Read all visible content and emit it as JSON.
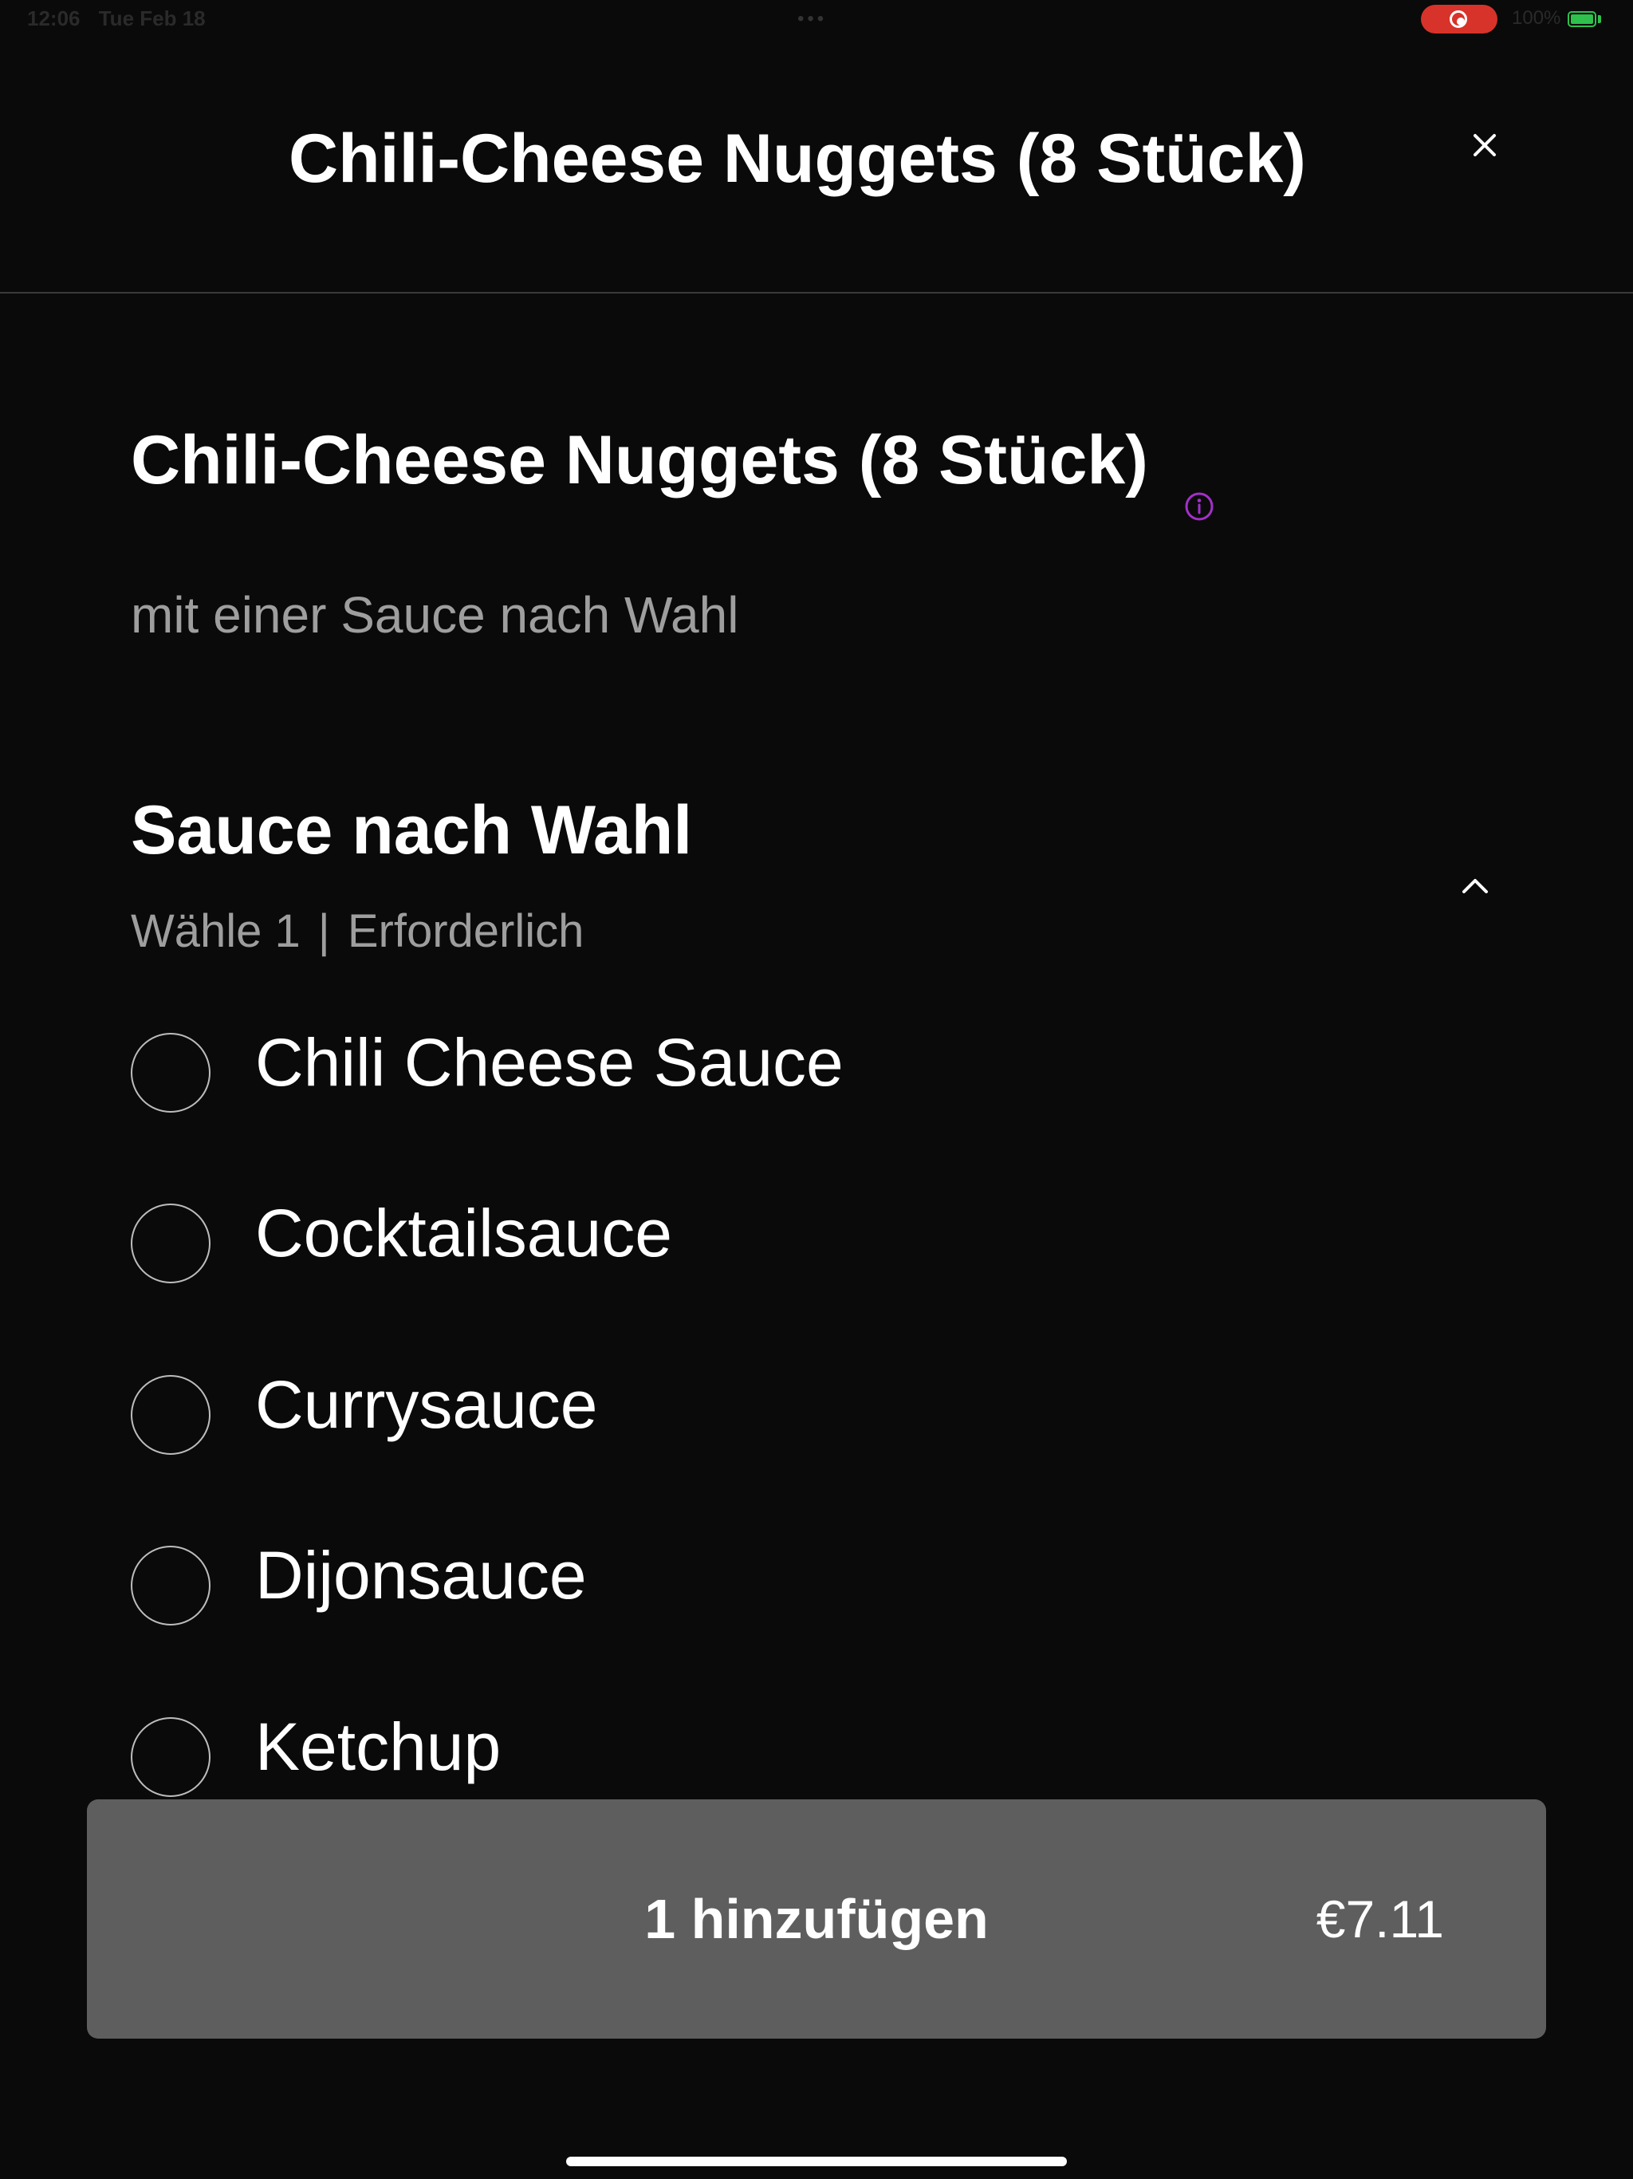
{
  "status_bar": {
    "time": "12:06",
    "date": "Tue Feb 18",
    "battery": "100%"
  },
  "header": {
    "title": "Chili-Cheese Nuggets (8 Stück)"
  },
  "item": {
    "title": "Chili-Cheese Nuggets (8 Stück)",
    "description": "mit einer Sauce nach Wahl"
  },
  "section": {
    "title": "Sauce nach Wahl",
    "choose": "Wähle 1",
    "separator": "|",
    "required": "Erforderlich",
    "options": [
      {
        "label": "Chili Cheese Sauce",
        "selected": false
      },
      {
        "label": "Cocktailsauce",
        "selected": false
      },
      {
        "label": "Currysauce",
        "selected": false
      },
      {
        "label": "Dijonsauce",
        "selected": false
      },
      {
        "label": "Ketchup",
        "selected": false
      }
    ]
  },
  "add_button": {
    "label": "1 hinzufügen",
    "price": "€7.11"
  },
  "colors": {
    "background": "#0a0a0a",
    "button": "#5e5e5e",
    "secondary_text": "#9e9e9e",
    "info_accent": "#a330c9",
    "record": "#d7332a",
    "battery": "#2ec14b"
  },
  "icons": {
    "close": "close-icon",
    "info": "info-icon",
    "collapse": "chevron-up-icon"
  }
}
